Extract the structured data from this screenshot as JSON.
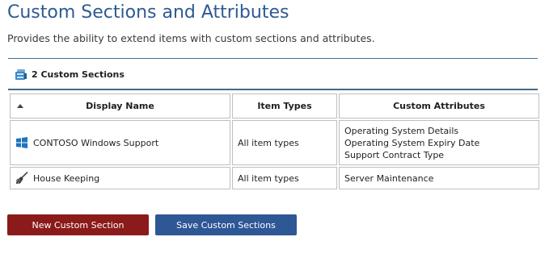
{
  "page": {
    "title": "Custom Sections and Attributes",
    "subtitle": "Provides the ability to extend items with custom sections and attributes."
  },
  "section_header": {
    "label": "2 Custom Sections",
    "icon": "custom-sections-icon"
  },
  "table": {
    "columns": [
      "Display Name",
      "Item Types",
      "Custom Attributes"
    ],
    "sort_indicator": "ascending",
    "rows": [
      {
        "icon": "windows-logo-icon",
        "display_name": "CONTOSO Windows Support",
        "item_types": "All item types",
        "attributes": [
          "Operating System Details",
          "Operating System Expiry Date",
          "Support Contract Type"
        ]
      },
      {
        "icon": "broom-icon",
        "display_name": "House Keeping",
        "item_types": "All item types",
        "attributes": [
          "Server Maintenance"
        ]
      }
    ]
  },
  "buttons": {
    "new_label": "New Custom Section",
    "save_label": "Save Custom Sections"
  },
  "colors": {
    "title": "#2e5a92",
    "rule": "#3f6b8f",
    "new_button": "#8b1a1a",
    "save_button": "#2e5796",
    "windows_blue": "#1e73be"
  }
}
